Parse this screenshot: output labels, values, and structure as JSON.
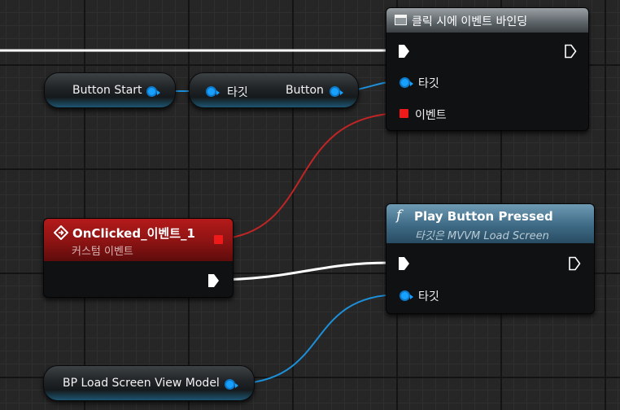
{
  "nodes": {
    "bind_event": {
      "title": "클릭 시에 이벤트 바인딩",
      "pin_target": "타깃",
      "pin_event": "이벤트"
    },
    "button_start": {
      "label": "Button Start"
    },
    "get_button": {
      "pin_target": "타깃",
      "pin_output": "Button"
    },
    "custom_event": {
      "title": "OnClicked_이벤트_1",
      "subtitle": "커스텀 이벤트"
    },
    "play_button_pressed": {
      "title": "Play Button Pressed",
      "subtitle": "타깃은 MVVM Load Screen",
      "function_symbol": "f",
      "pin_target": "타깃"
    },
    "view_model": {
      "label": "BP Load Screen View Model"
    }
  },
  "colors": {
    "exec_wire": "#ffffff",
    "object_wire": "#1c8fd8",
    "delegate_wire": "#c02525",
    "object_pin": "#18a0ff",
    "delegate_pin": "#ee1a1a",
    "event_header": "#8c1313",
    "function_header": "#3e6a85",
    "bind_header": "#6b7276"
  },
  "icons": {
    "bind_node_icon": "event-dispatcher-icon",
    "event_node_icon": "custom-event-diamond-icon",
    "function_node_icon": "function-icon"
  }
}
